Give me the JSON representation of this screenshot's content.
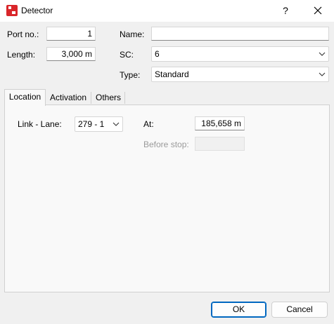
{
  "window": {
    "title": "Detector",
    "help_label": "?"
  },
  "fields": {
    "port_no_label": "Port no.:",
    "port_no_value": "1",
    "length_label": "Length:",
    "length_value": "3,000 m",
    "name_label": "Name:",
    "name_value": "",
    "sc_label": "SC:",
    "sc_value": "6",
    "type_label": "Type:",
    "type_value": "Standard"
  },
  "tabs": [
    {
      "label": "Location",
      "active": true
    },
    {
      "label": "Activation",
      "active": false
    },
    {
      "label": "Others",
      "active": false
    }
  ],
  "location": {
    "link_lane_label": "Link - Lane:",
    "link_lane_value": "279 - 1",
    "at_label": "At:",
    "at_value": "185,658 m",
    "before_stop_label": "Before stop:",
    "before_stop_value": ""
  },
  "buttons": {
    "ok": "OK",
    "cancel": "Cancel"
  },
  "icons": {
    "app": "detector-app-icon",
    "close": "close-icon",
    "dropdown": "chevron-down-icon"
  }
}
